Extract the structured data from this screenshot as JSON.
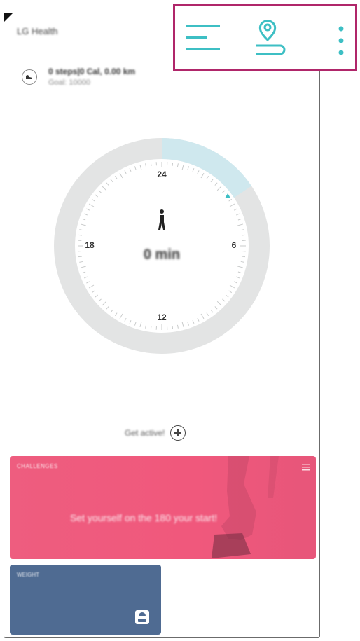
{
  "app": {
    "title": "LG Health"
  },
  "toolbar": {
    "icons": [
      "list-icon",
      "map-route-icon",
      "more-vert-icon"
    ],
    "accent_color": "#3dbfc4"
  },
  "summary": {
    "line1": "0 steps|0 Cal, 0.00 km",
    "line2": "Goal: 10000"
  },
  "dial": {
    "labels": {
      "top": "24",
      "right": "6",
      "bottom": "12",
      "left": "18"
    },
    "value": "0 min",
    "progress_color": "#cfe8ee",
    "track_color": "#e3e4e4"
  },
  "get_active": {
    "label": "Get active!"
  },
  "cards": {
    "challenge": {
      "label": "CHALLENGES",
      "text": "Set yourself on the 180 your start!",
      "color": "#ef5a7e"
    },
    "weight": {
      "label": "WEIGHT",
      "color": "#4f6b92"
    }
  }
}
